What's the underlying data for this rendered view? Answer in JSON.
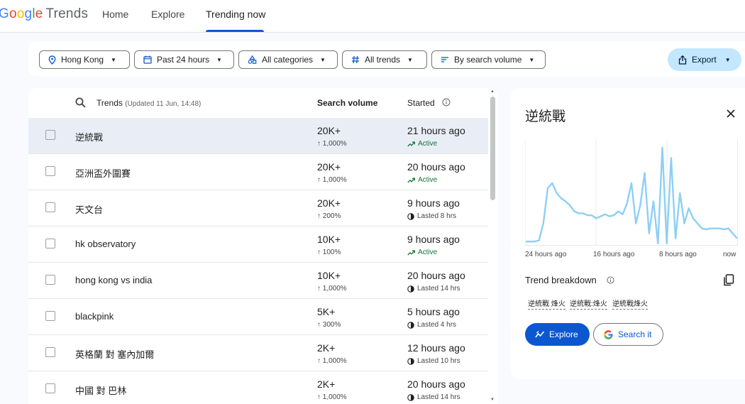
{
  "header": {
    "logo_google": "Google",
    "logo_trends": "Trends",
    "nav": [
      {
        "label": "Home"
      },
      {
        "label": "Explore"
      },
      {
        "label": "Trending now"
      }
    ],
    "active_nav": "Trending now"
  },
  "filters": {
    "location": "Hong Kong",
    "time": "Past 24 hours",
    "category": "All categories",
    "trends": "All trends",
    "sort": "By search volume",
    "export": "Export"
  },
  "list": {
    "header": {
      "trends": "Trends",
      "updated": "(Updated 11 Jun, 14:48)",
      "volume": "Search volume",
      "started": "Started"
    },
    "rows": [
      {
        "name": "逆統戰",
        "volume": "20K+",
        "change": "↑ 1,000%",
        "started": "21 hours ago",
        "status": "Active",
        "status_type": "active"
      },
      {
        "name": "亞洲盃外圍賽",
        "volume": "20K+",
        "change": "↑ 1,000%",
        "started": "20 hours ago",
        "status": "Active",
        "status_type": "active"
      },
      {
        "name": "天文台",
        "volume": "20K+",
        "change": "↑ 200%",
        "started": "9 hours ago",
        "status": "Lasted 8 hrs",
        "status_type": "lasted"
      },
      {
        "name": "hk observatory",
        "volume": "10K+",
        "change": "↑ 100%",
        "started": "9 hours ago",
        "status": "Active",
        "status_type": "active"
      },
      {
        "name": "hong kong vs india",
        "volume": "10K+",
        "change": "↑ 1,000%",
        "started": "20 hours ago",
        "status": "Lasted 14 hrs",
        "status_type": "lasted"
      },
      {
        "name": "blackpink",
        "volume": "5K+",
        "change": "↑ 300%",
        "started": "5 hours ago",
        "status": "Lasted 4 hrs",
        "status_type": "lasted"
      },
      {
        "name": "英格蘭 對 塞內加爾",
        "volume": "2K+",
        "change": "↑ 1,000%",
        "started": "12 hours ago",
        "status": "Lasted 10 hrs",
        "status_type": "lasted"
      },
      {
        "name": "中國 對 巴林",
        "volume": "2K+",
        "change": "↑ 1,000%",
        "started": "20 hours ago",
        "status": "Lasted 14 hrs",
        "status_type": "lasted"
      }
    ],
    "selected_index": 0
  },
  "detail": {
    "title": "逆統戰",
    "chart_x_labels": [
      "24 hours ago",
      "16 hours ago",
      "8 hours ago",
      "now"
    ],
    "breakdown_title": "Trend breakdown",
    "breakdown_tags": [
      "逆統戰 烽火",
      "逆統戰:烽火",
      "逆統戰烽火"
    ],
    "explore_label": "Explore",
    "search_label": "Search it",
    "line_color": "#8dcff5"
  },
  "chart_data": {
    "type": "line",
    "xlabel": "",
    "ylabel": "",
    "x_labels": [
      "24 hours ago",
      "16 hours ago",
      "8 hours ago",
      "now"
    ],
    "series": [
      {
        "values": [
          2,
          2,
          2,
          3,
          20,
          55,
          60,
          50,
          45,
          42,
          38,
          32,
          30,
          30,
          28,
          28,
          25,
          27,
          29,
          27,
          28,
          32,
          29,
          40,
          60,
          20,
          38,
          70,
          10,
          42,
          0,
          95,
          0,
          85,
          5,
          50,
          20,
          35,
          25,
          20,
          15,
          14,
          15,
          15,
          15,
          14,
          15,
          10,
          5
        ]
      }
    ],
    "ylim": [
      0,
      100
    ],
    "grid": true
  }
}
